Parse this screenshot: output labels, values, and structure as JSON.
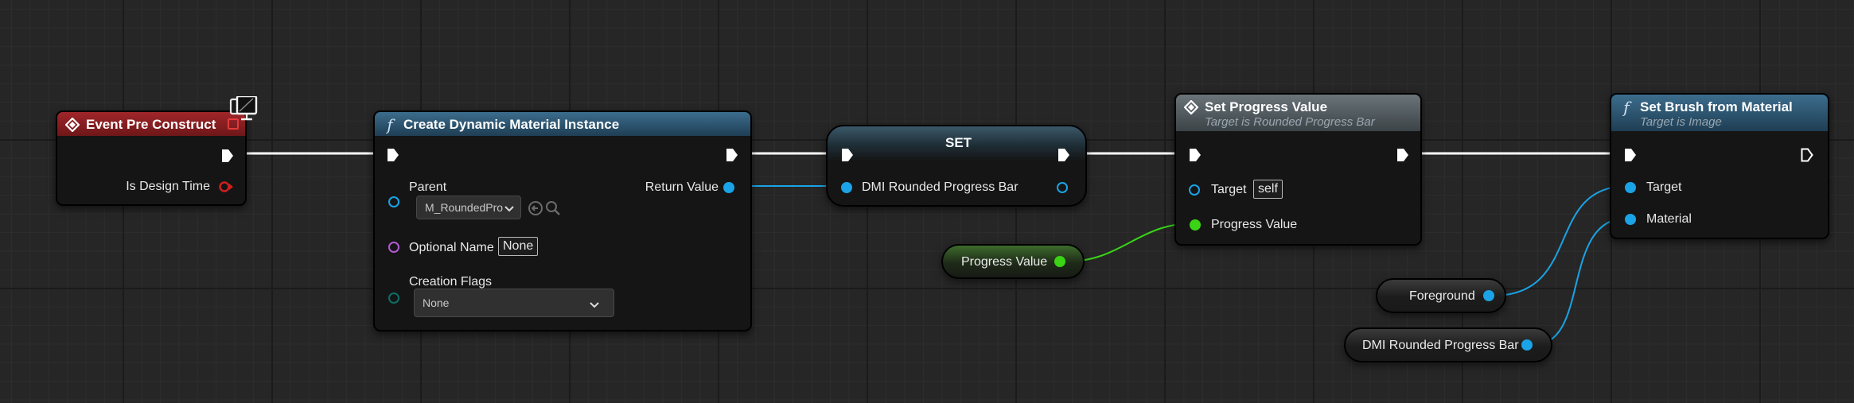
{
  "colors": {
    "exec": "#ffffff",
    "object": "#1aa3e6",
    "float": "#3ad316",
    "bool": "#cf1f1f",
    "name": "#b45ad1",
    "byte": "#0c6e66"
  },
  "nodes": {
    "event_pre_construct": {
      "title": "Event Pre Construct",
      "icon": "event-diamond-icon",
      "badge_icon": "monitor-icon",
      "out_is_design_time": "Is Design Time"
    },
    "create_dmi": {
      "title": "Create Dynamic Material Instance",
      "icon": "function-icon",
      "in_parent": "Parent",
      "parent_value": "M_RoundedProg",
      "in_optional_name": "Optional Name",
      "optional_name_value": "None",
      "in_creation_flags": "Creation Flags",
      "creation_flags_value": "None",
      "out_return_value": "Return Value"
    },
    "set_node": {
      "title": "SET",
      "in_variable": "DMI Rounded Progress Bar"
    },
    "set_progress_value": {
      "title": "Set Progress Value",
      "subtitle": "Target is Rounded Progress Bar",
      "icon": "function-diamond-icon",
      "in_target": "Target",
      "target_value": "self",
      "in_progress_value": "Progress Value"
    },
    "set_brush_from_material": {
      "title": "Set Brush from Material",
      "subtitle": "Target is Image",
      "icon": "function-icon",
      "in_target": "Target",
      "in_material": "Material"
    },
    "var_progress_value": {
      "label": "Progress Value"
    },
    "var_foreground": {
      "label": "Foreground"
    },
    "var_dmi": {
      "label": "DMI Rounded Progress Bar"
    }
  }
}
